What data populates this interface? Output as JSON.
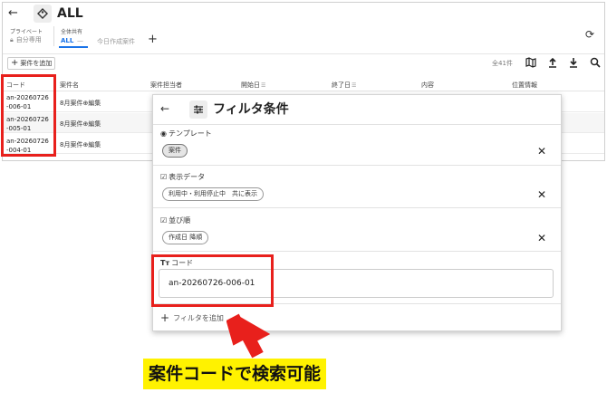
{
  "header": {
    "title": "ALL",
    "group_private": "プライベート",
    "group_shared": "全体共有",
    "private_tab": "自分専用",
    "tab_all": "ALL",
    "tab_all_more": "—",
    "tab_today": "今日作成案件"
  },
  "toolbar": {
    "add_case_label": "案件を追加",
    "count": "全41件"
  },
  "table": {
    "columns": [
      "コード",
      "案件名",
      "案件担当者",
      "開始日",
      "終了日",
      "内容",
      "位置情報"
    ],
    "rows": [
      {
        "code_line1": "an-20260726",
        "code_line2": "-006-01",
        "name": "8月案件⊕編集"
      },
      {
        "code_line1": "an-20260726",
        "code_line2": "-005-01",
        "name": "8月案件⊕編集"
      },
      {
        "code_line1": "an-20260726",
        "code_line2": "-004-01",
        "name": "8月案件⊕編集"
      }
    ]
  },
  "panel": {
    "title": "フィルタ条件",
    "template_label": "テンプレート",
    "template_chip": "案件",
    "display_label": "表示データ",
    "display_chip": "利用中・利用停止中　共に表示",
    "sort_label": "並び順",
    "sort_chip": "作成日 降順",
    "code_label": "コード",
    "code_value": "an-20260726-006-01",
    "add_filter": "フィルタを追加"
  },
  "caption": "案件コードで検索可能",
  "colors": {
    "highlight": "#e8201c",
    "caption_bg": "#fff200",
    "accent": "#1a73e8"
  }
}
